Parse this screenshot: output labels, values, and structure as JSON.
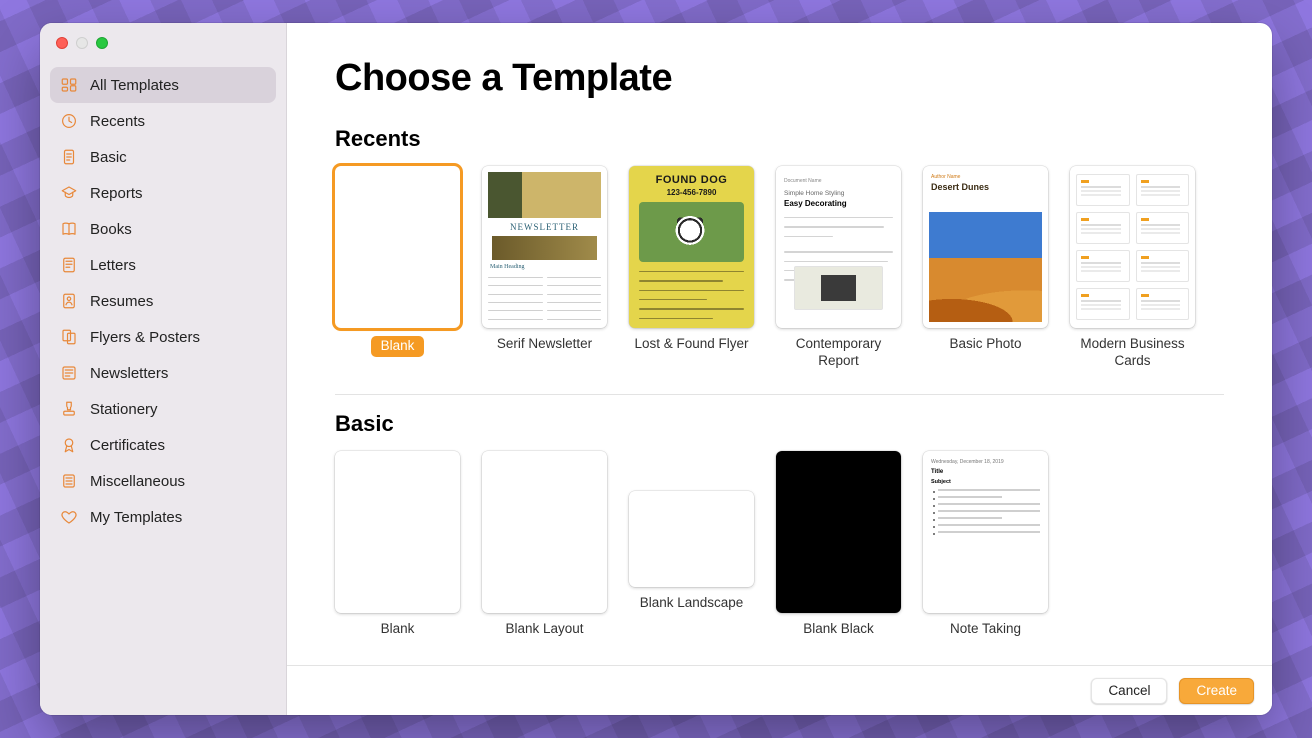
{
  "page_title": "Choose a Template",
  "sidebar": {
    "items": [
      {
        "icon": "grid",
        "label": "All Templates",
        "selected": true
      },
      {
        "icon": "clock",
        "label": "Recents"
      },
      {
        "icon": "doc",
        "label": "Basic"
      },
      {
        "icon": "grad",
        "label": "Reports"
      },
      {
        "icon": "book",
        "label": "Books"
      },
      {
        "icon": "letter",
        "label": "Letters"
      },
      {
        "icon": "person",
        "label": "Resumes"
      },
      {
        "icon": "flyer",
        "label": "Flyers & Posters"
      },
      {
        "icon": "news",
        "label": "Newsletters"
      },
      {
        "icon": "stamp",
        "label": "Stationery"
      },
      {
        "icon": "ribbon",
        "label": "Certificates"
      },
      {
        "icon": "misc",
        "label": "Miscellaneous"
      },
      {
        "icon": "heart",
        "label": "My Templates"
      }
    ]
  },
  "sections": {
    "recents": {
      "title": "Recents",
      "templates": [
        {
          "label": "Blank",
          "kind": "blank",
          "selected": true
        },
        {
          "label": "Serif Newsletter",
          "kind": "newsletter",
          "preview": {
            "banner": "NEWSLETTER",
            "heading": "Main Heading"
          }
        },
        {
          "label": "Lost & Found Flyer",
          "kind": "lostfound",
          "preview": {
            "headline": "FOUND DOG",
            "phone": "123-456-7890"
          }
        },
        {
          "label": "Contemporary Report",
          "kind": "report",
          "preview": {
            "kicker": "Simple Home Styling",
            "headline": "Easy Decorating"
          }
        },
        {
          "label": "Basic Photo",
          "kind": "photo",
          "preview": {
            "author": "Author Name",
            "title": "Desert Dunes"
          }
        },
        {
          "label": "Modern Business Cards",
          "kind": "bizcards"
        }
      ]
    },
    "basic": {
      "title": "Basic",
      "templates": [
        {
          "label": "Blank",
          "kind": "blank"
        },
        {
          "label": "Blank Layout",
          "kind": "blank"
        },
        {
          "label": "Blank Landscape",
          "kind": "blank-landscape"
        },
        {
          "label": "Blank Black",
          "kind": "blank-black"
        },
        {
          "label": "Note Taking",
          "kind": "notetaking",
          "preview": {
            "date": "Wednesday, December 18, 2019",
            "title": "Title",
            "subject": "Subject"
          }
        }
      ]
    }
  },
  "footer": {
    "cancel": "Cancel",
    "create": "Create"
  }
}
